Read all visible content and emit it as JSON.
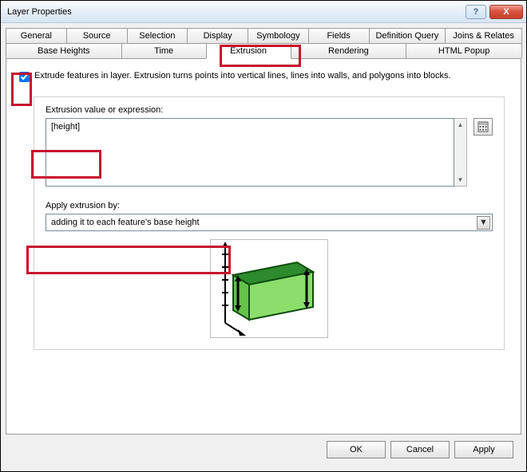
{
  "window": {
    "title": "Layer Properties"
  },
  "tabs_row1": [
    "General",
    "Source",
    "Selection",
    "Display",
    "Symbology",
    "Fields",
    "Definition Query",
    "Joins & Relates"
  ],
  "tabs_row2": [
    "Base Heights",
    "Time",
    "Extrusion",
    "Rendering",
    "HTML Popup"
  ],
  "active_tab": "Extrusion",
  "extrude": {
    "checkbox_label": "Extrude features in layer.  Extrusion turns points into vertical lines, lines into walls, and polygons into blocks.",
    "checked": true
  },
  "expression": {
    "label": "Extrusion value or expression:",
    "value": "[height]"
  },
  "apply_by": {
    "label": "Apply extrusion by:",
    "value": "adding it to each feature's base height"
  },
  "buttons": {
    "ok": "OK",
    "cancel": "Cancel",
    "apply": "Apply"
  },
  "icons": {
    "help": "?",
    "close": "X",
    "up": "▲",
    "down": "▼",
    "dd": "▼"
  }
}
